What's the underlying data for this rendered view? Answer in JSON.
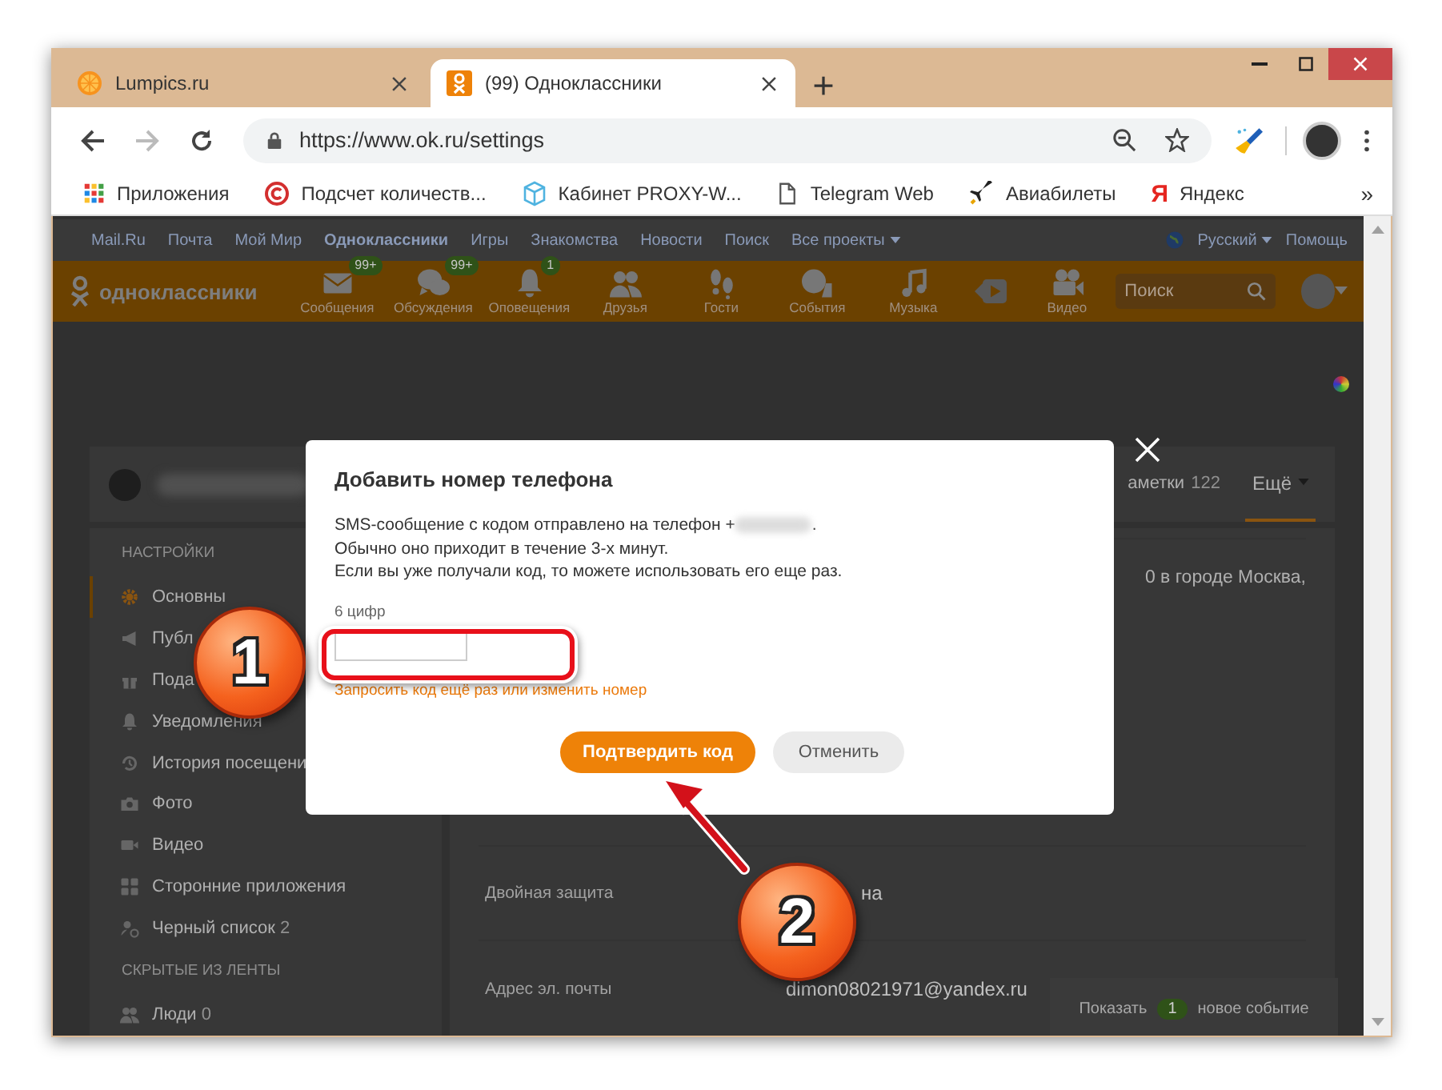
{
  "browser": {
    "tabs": [
      {
        "title": "Lumpics.ru",
        "selected": false
      },
      {
        "title": "(99) Одноклассники",
        "selected": true
      }
    ],
    "url": "https://www.ok.ru/settings",
    "bookmarks": [
      {
        "kind": "apps",
        "label": "Приложения"
      },
      {
        "kind": "counter",
        "label": "Подсчет количеств..."
      },
      {
        "kind": "cube",
        "label": "Кабинет PROXY-W..."
      },
      {
        "kind": "page",
        "label": "Telegram Web"
      },
      {
        "kind": "plane",
        "label": "Авиабилеты"
      },
      {
        "kind": "letter",
        "glyph": "Я",
        "label": "Яндекс"
      }
    ],
    "more_bookmarks": "»"
  },
  "portal_bar": {
    "links": [
      {
        "label": "Mail.Ru",
        "selected": false
      },
      {
        "label": "Почта",
        "selected": false
      },
      {
        "label": "Мой Мир",
        "selected": false
      },
      {
        "label": "Одноклассники",
        "selected": true
      },
      {
        "label": "Игры",
        "selected": false
      },
      {
        "label": "Знакомства",
        "selected": false
      },
      {
        "label": "Новости",
        "selected": false
      },
      {
        "label": "Поиск",
        "selected": false
      }
    ],
    "projects": "Все проекты",
    "language": "Русский",
    "help": "Помощь"
  },
  "header": {
    "logo": "одноклассники",
    "nav": [
      {
        "kind": "envelope",
        "label": "Сообщения",
        "badge": "99+"
      },
      {
        "kind": "chat",
        "label": "Обсуждения",
        "badge": "99+"
      },
      {
        "kind": "bell",
        "label": "Оповещения",
        "badge": "1"
      },
      {
        "kind": "friends",
        "label": "Друзья"
      },
      {
        "kind": "steps",
        "label": "Гости"
      },
      {
        "kind": "events",
        "label": "События"
      },
      {
        "kind": "music",
        "label": "Музыка"
      },
      {
        "kind": "play"
      },
      {
        "kind": "camera",
        "label": "Видео"
      }
    ],
    "search": {
      "placeholder": "Поиск"
    }
  },
  "profile": {
    "tabs": [
      {
        "label": "аметки",
        "count": "122",
        "selected": false
      },
      {
        "label": "Ещё",
        "selected": true
      }
    ]
  },
  "sidebar": {
    "heading": "НАСТРОЙКИ",
    "items": [
      {
        "kind": "gear",
        "label": "Основны",
        "selected": true
      },
      {
        "kind": "megaphone",
        "label": "Публ",
        "selected": false
      },
      {
        "kind": "gift",
        "label": "Пода",
        "selected": false
      },
      {
        "kind": "bell",
        "label": "Уведомления",
        "selected": false
      },
      {
        "kind": "history",
        "label": "История посещени",
        "selected": false
      },
      {
        "kind": "photo",
        "label": "Фото",
        "selected": false
      },
      {
        "kind": "video",
        "label": "Видео",
        "selected": false
      },
      {
        "kind": "apps",
        "label": "Сторонние приложения",
        "selected": false
      },
      {
        "kind": "blocked",
        "label": "Черный список",
        "count": "2",
        "selected": false
      }
    ],
    "hidden_heading": "СКРЫТЫЕ ИЗ ЛЕНТЫ",
    "hidden_items": [
      {
        "kind": "people",
        "label": "Люди",
        "count": "0",
        "selected": false
      }
    ]
  },
  "main": {
    "intro": "0 в городе Москва,",
    "rows": [
      {
        "label": "Двойная защита",
        "value": "на"
      },
      {
        "label": "Адрес эл. почты",
        "value": "dimon08021971@yandex.ru"
      }
    ]
  },
  "notification": {
    "before": "Показать",
    "count": "1",
    "after": "новое событие"
  },
  "dialog": {
    "title": "Добавить номер телефона",
    "message_start": "SMS-сообщение с кодом отправлено на телефон +",
    "message_end": ".",
    "lines": [
      "Обычно оно приходит в течение 3-х минут.",
      "Если вы уже получали код, то можете использовать его еще раз."
    ],
    "code_label": "6 цифр",
    "link": "Запросить код ещё раз или изменить номер",
    "buttons": [
      {
        "kind": "primary",
        "label": "Подтвердить код"
      },
      {
        "kind": "secondary",
        "label": "Отменить"
      }
    ]
  },
  "annotations": [
    {
      "label": "1"
    },
    {
      "label": "2"
    }
  ]
}
